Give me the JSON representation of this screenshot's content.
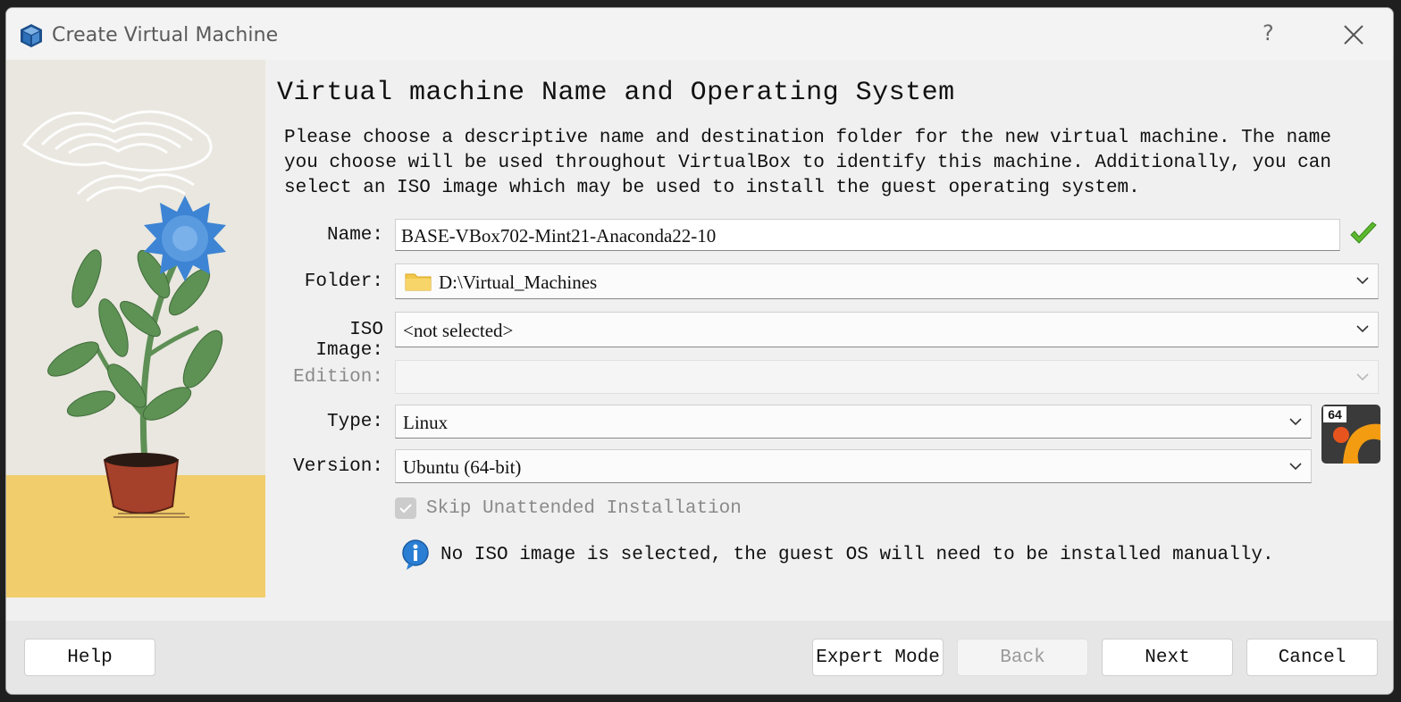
{
  "window": {
    "title": "Create Virtual Machine",
    "help_glyph": "?",
    "close_glyph": "✕"
  },
  "page": {
    "heading": "Virtual machine Name and Operating System",
    "description": "Please choose a descriptive name and destination folder for the new virtual machine. The name you choose will be used throughout VirtualBox to identify this machine. Additionally, you can select an ISO image which may be used to install the guest operating system."
  },
  "form": {
    "name_label": "Name:",
    "name_value": "BASE-VBox702-Mint21-Anaconda22-10",
    "folder_label": "Folder:",
    "folder_value": "D:\\Virtual_Machines",
    "iso_label": "ISO Image:",
    "iso_value": "<not selected>",
    "edition_label": "Edition:",
    "edition_value": "",
    "type_label": "Type:",
    "type_value": "Linux",
    "version_label": "Version:",
    "version_value": "Ubuntu (64-bit)",
    "os_badge": "64",
    "skip_label": "Skip Unattended Installation",
    "skip_checked": true,
    "info_message": "No ISO image is selected, the guest OS will need to be installed manually."
  },
  "buttons": {
    "help": "Help",
    "expert_mode": "Expert Mode",
    "back": "Back",
    "next": "Next",
    "cancel": "Cancel"
  },
  "colors": {
    "accent_check": "#5cb82e",
    "info_blue": "#2a7fd4",
    "illus_yellow": "#f1cd6b",
    "flower_blue": "#3d84d4"
  }
}
